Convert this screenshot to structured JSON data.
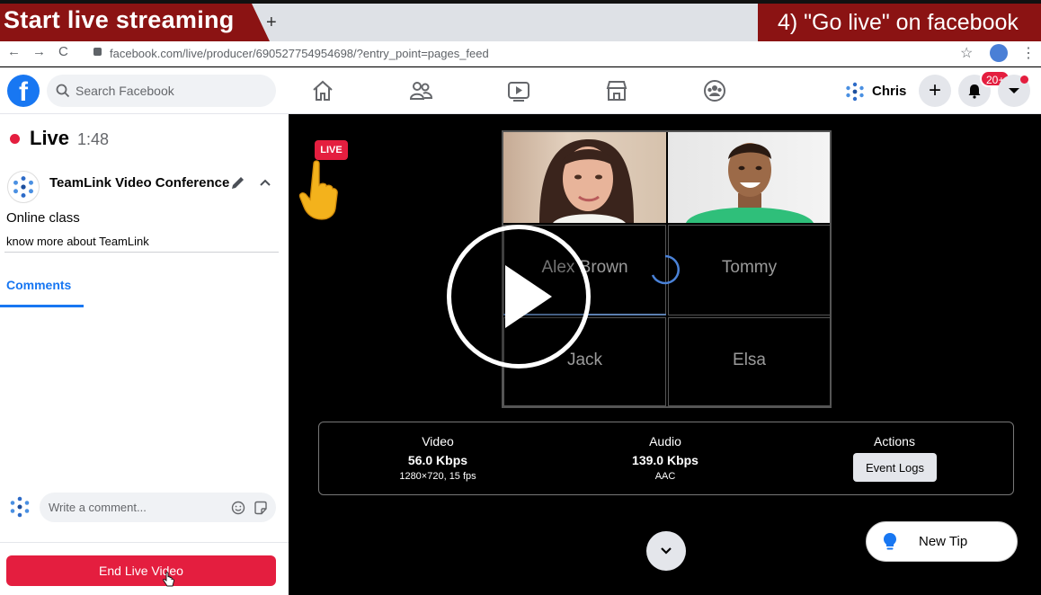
{
  "overlay": {
    "left_banner": "Start live streaming",
    "right_banner": "4) \"Go live\" on facebook",
    "new_tab": "+"
  },
  "browser": {
    "url": "facebook.com/live/producer/690527754954698/?entry_point=pages_feed",
    "back": "←",
    "forward": "→",
    "reload": "C",
    "star": "☆",
    "menu": "⋮"
  },
  "fb_header": {
    "logo": "f",
    "search_placeholder": "Search Facebook",
    "profile_name": "Chris",
    "notification_badge": "20+",
    "create": "+"
  },
  "left_panel": {
    "live_label": "Live",
    "elapsed": "1:48",
    "page_name": "TeamLink Video Conference",
    "video_title": "Online class",
    "video_description": "know more about TeamLink",
    "comments_tab": "Comments",
    "comment_placeholder": "Write a comment...",
    "end_button": "End Live Video"
  },
  "main": {
    "live_badge": "LIVE",
    "participants": [
      "Alex Brown",
      "Tommy",
      "Jack",
      "Elsa"
    ],
    "stats": {
      "video_label": "Video",
      "video_value": "56.0 Kbps",
      "video_sub": "1280×720, 15 fps",
      "audio_label": "Audio",
      "audio_value": "139.0 Kbps",
      "audio_sub": "AAC",
      "actions_label": "Actions",
      "event_logs": "Event Logs"
    },
    "new_tip": "New Tip"
  },
  "colors": {
    "fb_blue": "#1877f2",
    "live_red": "#e41e3f",
    "banner_red": "#8b1313"
  }
}
